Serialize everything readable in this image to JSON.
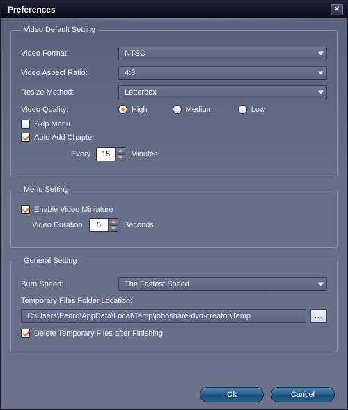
{
  "window": {
    "title": "Preferences"
  },
  "groups": {
    "video": {
      "legend": "Video Default Setting",
      "format_label": "Video Format:",
      "format_value": "NTSC",
      "aspect_label": "Video Aspect Ratio:",
      "aspect_value": "4:3",
      "resize_label": "Resize Method:",
      "resize_value": "Letterbox",
      "quality_label": "Video Quality:",
      "quality_options": {
        "high": "High",
        "medium": "Medium",
        "low": "Low"
      },
      "quality_selected": "high",
      "skip_menu_label": "Skip Menu",
      "skip_menu_checked": false,
      "auto_chapter_label": "Auto Add Chapter",
      "auto_chapter_checked": true,
      "chapter_every_label": "Every",
      "chapter_every_value": "15",
      "chapter_unit": "Minutes"
    },
    "menu": {
      "legend": "Menu Setting",
      "enable_miniature_label": "Enable Video Miniature",
      "enable_miniature_checked": true,
      "duration_label": "Video Duration",
      "duration_value": "5",
      "duration_unit": "Seconds"
    },
    "general": {
      "legend": "General Setting",
      "burn_speed_label": "Burn Speed:",
      "burn_speed_value": "The Fastest Speed",
      "temp_folder_label": "Temporary Files Folder Location:",
      "temp_folder_value": "C:\\Users\\Pedro\\AppData\\Local\\Temp\\joboshare-dvd-creator\\Temp",
      "browse_label": "...",
      "delete_temp_label": "Delete Temporary Files after Finishing",
      "delete_temp_checked": true
    }
  },
  "footer": {
    "ok": "Ok",
    "cancel": "Cancel"
  }
}
